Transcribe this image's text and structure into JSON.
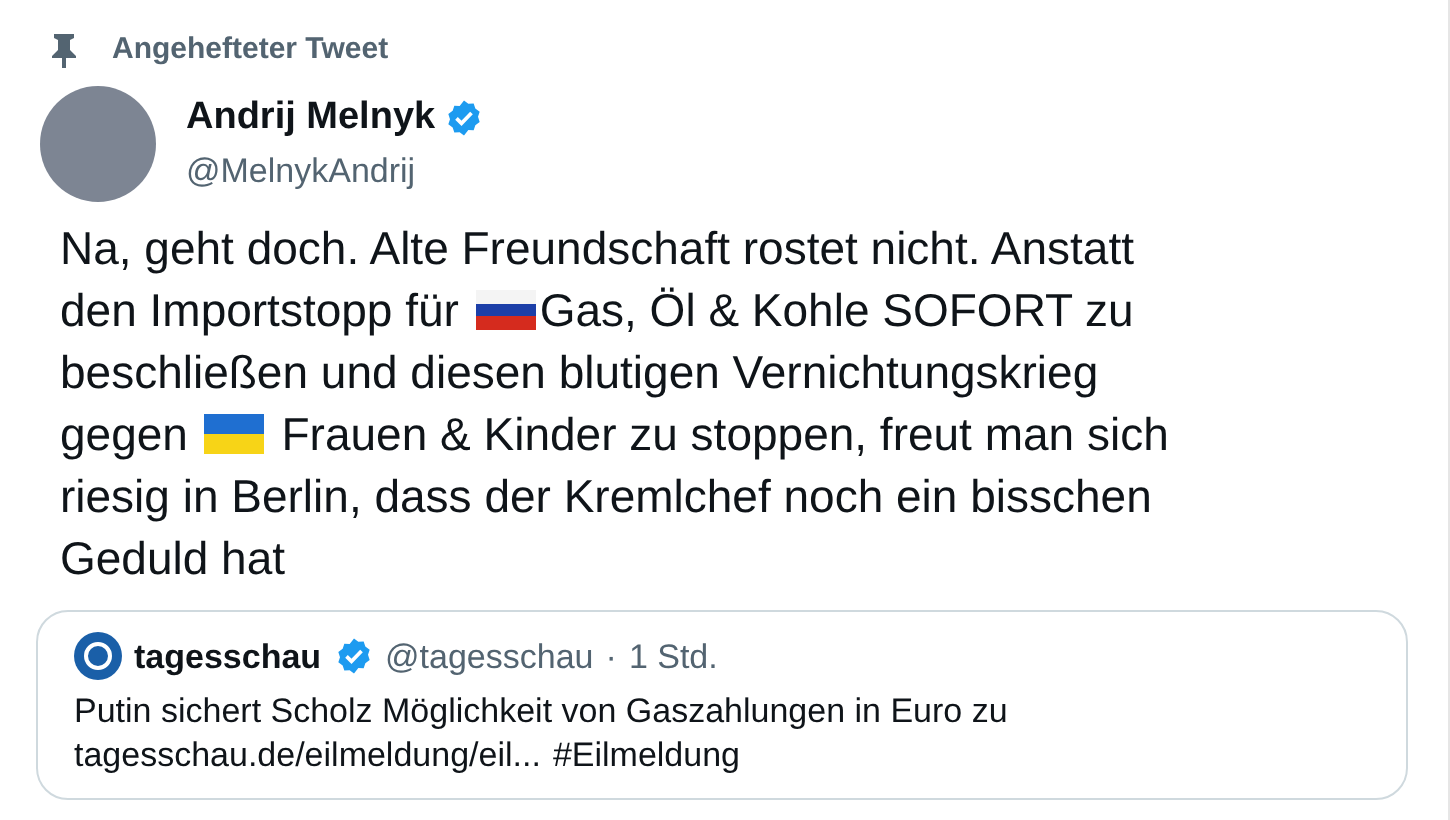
{
  "pinned_label": "Angehefteter Tweet",
  "author": {
    "name": "Andrij Melnyk",
    "handle": "@MelnykAndrij",
    "verified": true
  },
  "body": [
    {
      "kind": "text",
      "text": "Na, geht doch. Alte Freundschaft rostet nicht. Anstatt den Importstopp für "
    },
    {
      "kind": "flag_ru"
    },
    {
      "kind": "text",
      "text": "Gas, Öl & Kohle SOFORT zu beschließen und diesen blutigen Vernichtungskrieg gegen "
    },
    {
      "kind": "flag_ua"
    },
    {
      "kind": "text",
      "text": " Frauen & Kinder zu stoppen, freut man sich riesig in Berlin, dass der Kremlchef noch ein bisschen Geduld hat"
    }
  ],
  "quoted": {
    "name": "tagesschau",
    "verified": true,
    "handle": "@tagesschau",
    "separator": "·",
    "time": "1 Std.",
    "text": "Putin sichert Scholz Möglichkeit von Gaszahlungen in Euro zu",
    "link": "tagesschau.de/eilmeldung/eil...",
    "hashtag": "#Eilmeldung"
  }
}
